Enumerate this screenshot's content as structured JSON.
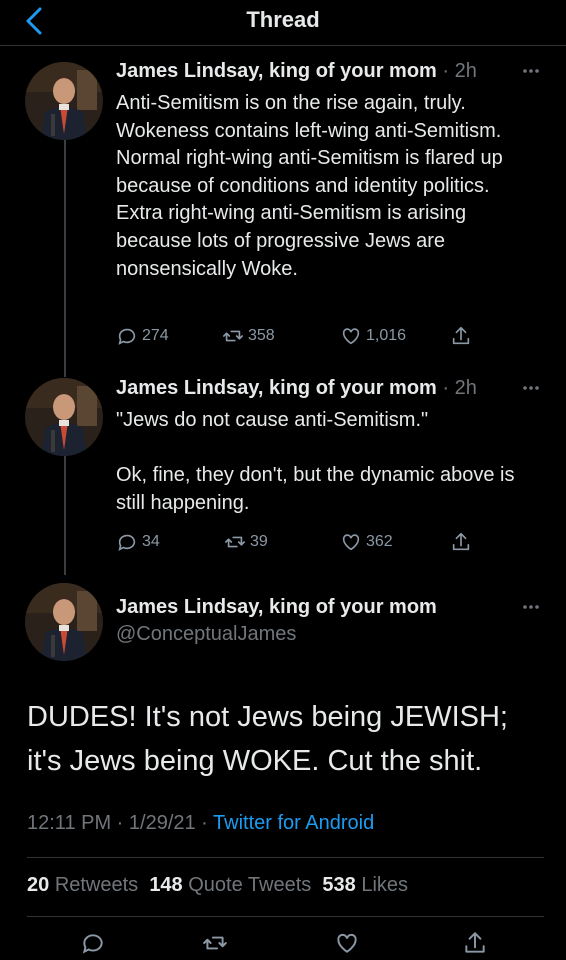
{
  "header": {
    "title": "Thread"
  },
  "thread": [
    {
      "author": "James Lindsay, king of your mom",
      "time": "· 2h",
      "text": "Anti-Semitism is on the rise again, truly. Wokeness contains left-wing anti-Semitism. Normal right-wing anti-Semitism is flared up because of conditions and identity politics. Extra right-wing anti-Semitism is arising because lots of progressive Jews are nonsensically Woke.",
      "replies": "274",
      "retweets": "358",
      "likes": "1,016"
    },
    {
      "author": "James Lindsay, king of your mom",
      "time": "· 2h",
      "text": "\"Jews do not cause anti-Semitism.\"\n\nOk, fine, they don't, but the dynamic above is still happening.",
      "replies": "34",
      "retweets": "39",
      "likes": "362"
    }
  ],
  "main_tweet": {
    "author": "James Lindsay, king of your mom",
    "handle": "@ConceptualJames",
    "text": "DUDES! It's not Jews being JEWISH; it's Jews being WOKE. Cut the shit.",
    "timestamp": "12:11 PM · 1/29/21 · ",
    "source": "Twitter for Android",
    "retweets_count": "20",
    "retweets_label": "Retweets",
    "quote_count": "148",
    "quote_label": "Quote Tweets",
    "likes_count": "538",
    "likes_label": "Likes"
  },
  "icons": {
    "back": "chevron-left-icon",
    "reply": "reply-icon",
    "retweet": "retweet-icon",
    "like": "heart-icon",
    "share": "share-icon",
    "more": "more-horizontal-icon"
  },
  "colors": {
    "background": "#000000",
    "accent": "#1d9bf0",
    "text": "#e7e9ea",
    "muted": "#71767b"
  }
}
